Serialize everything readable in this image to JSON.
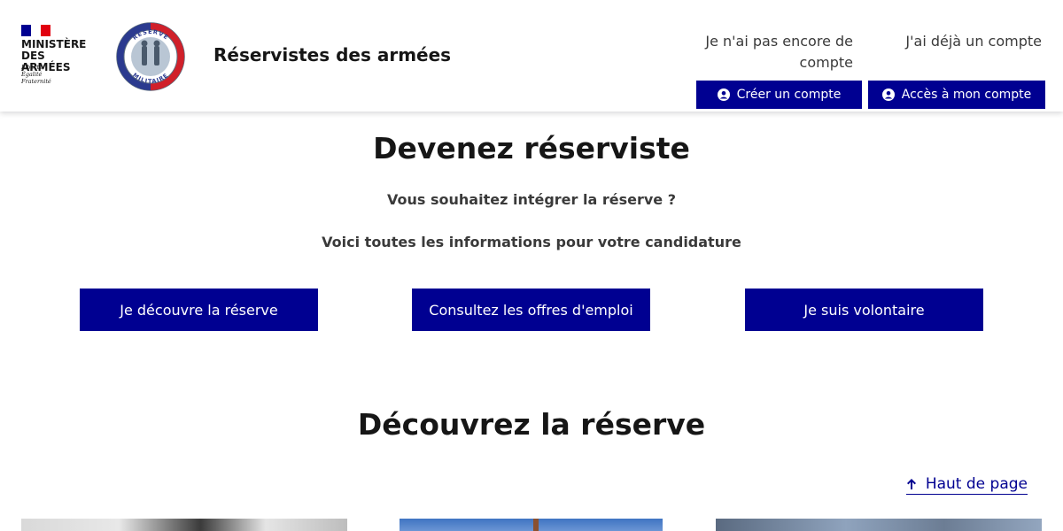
{
  "header": {
    "ministry": {
      "title": "MINISTÈRE\nDES ARMÉES",
      "motto": "Liberté\nÉgalité\nFraternité"
    },
    "logo": {
      "top_text": "RÉSERVE",
      "bottom_text": "MILITAIRE"
    },
    "site_title": "Réservistes des armées",
    "no_account_text": "Je n'ai pas encore de compte",
    "has_account_text": "J'ai déjà un compte",
    "create_account_label": "Créer un compte",
    "access_account_label": "Accès à mon compte"
  },
  "hero": {
    "title": "Devenez réserviste",
    "subtitle_1": "Vous souhaitez intégrer la réserve ?",
    "subtitle_2": "Voici toutes les informations pour votre candidature",
    "buttons": [
      {
        "label": "Je découvre la réserve"
      },
      {
        "label": "Consultez les offres d'emploi"
      },
      {
        "label": "Je suis volontaire"
      }
    ]
  },
  "discover": {
    "title": "Découvrez la réserve"
  },
  "back_to_top": "Haut de page",
  "colors": {
    "primary": "#000091",
    "flag_blue": "#000091",
    "flag_red": "#E1000F",
    "text": "#161616"
  },
  "icons": {
    "user": "user-circle-icon",
    "arrow": "arrow-up-icon"
  }
}
